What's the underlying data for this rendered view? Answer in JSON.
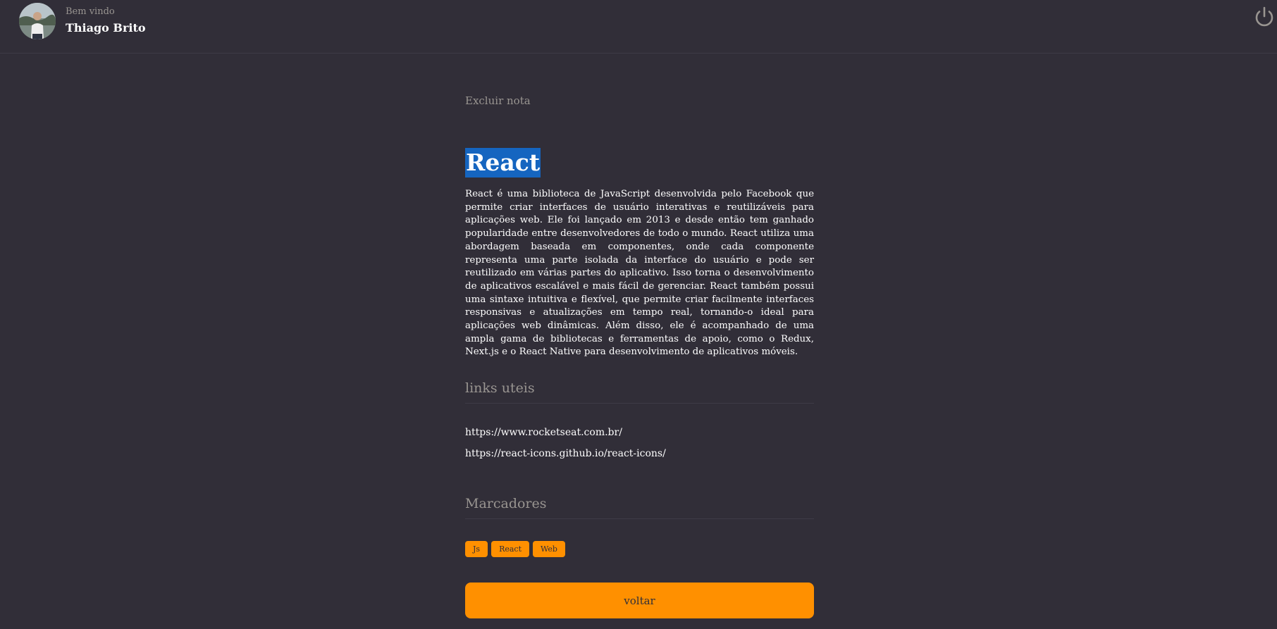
{
  "header": {
    "welcome_text": "Bem vindo",
    "user_name": "Thiago Brito",
    "logout_icon": "power-icon"
  },
  "note": {
    "delete_label": "Excluir nota",
    "title": "React",
    "body": "React é uma biblioteca de JavaScript desenvolvida pelo Facebook que permite criar interfaces de usuário interativas e reutilizáveis para aplicações web. Ele foi lançado em 2013 e desde então tem ganhado popularidade entre desenvolvedores de todo o mundo. React utiliza uma abordagem baseada em componentes, onde cada componente representa uma parte isolada da interface do usuário e pode ser reutilizado em várias partes do aplicativo. Isso torna o desenvolvimento de aplicativos escalável e mais fácil de gerenciar. React também possui uma sintaxe intuitiva e flexível, que permite criar facilmente interfaces responsivas e atualizações em tempo real, tornando-o ideal para aplicações web dinâmicas. Além disso, ele é acompanhado de uma ampla gama de bibliotecas e ferramentas de apoio, como o Redux, Next.js e o React Native para desenvolvimento de aplicativos móveis.",
    "links_title": "links uteis",
    "links": [
      "https://www.rocketseat.com.br/",
      "https://react-icons.github.io/react-icons/"
    ],
    "tags_title": "Marcadores",
    "tags": [
      "Js",
      "React",
      "Web"
    ],
    "back_label": "voltar"
  },
  "colors": {
    "background": "#312e38",
    "accent": "#ff9000",
    "selection": "#1565c0",
    "muted_text": "#999591"
  }
}
